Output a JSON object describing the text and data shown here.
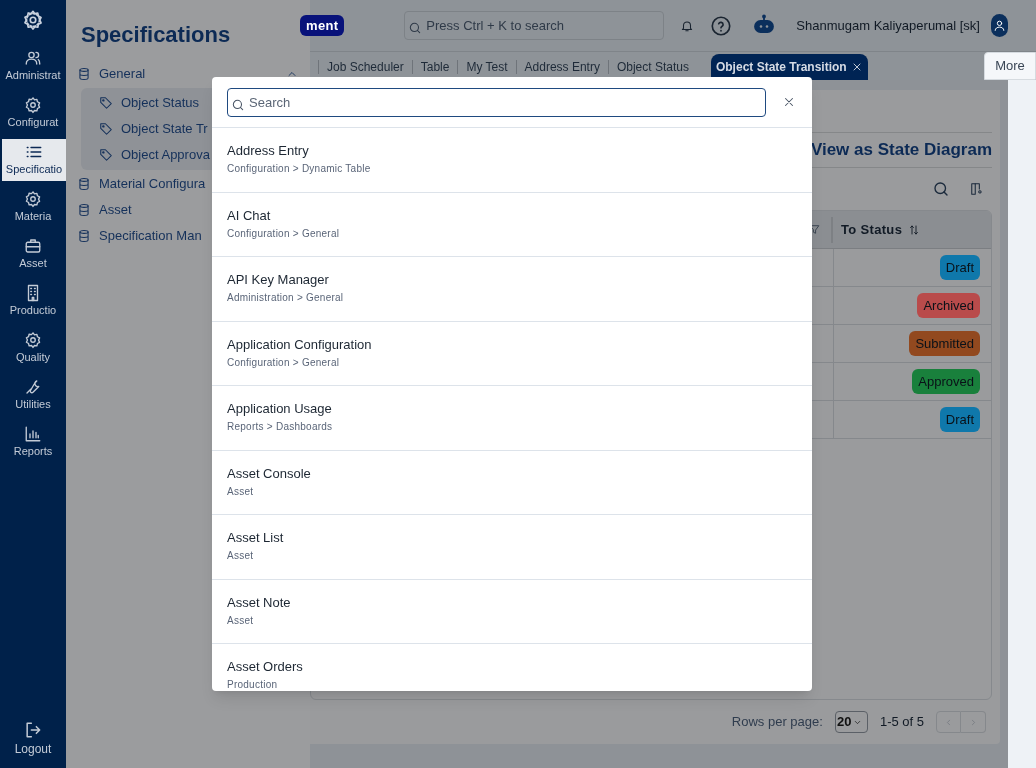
{
  "nav": {
    "items": [
      {
        "label": "Administrat",
        "selected": false
      },
      {
        "label": "Configurat",
        "selected": false
      },
      {
        "label": "Specificatio",
        "selected": true
      },
      {
        "label": "Materia",
        "selected": false
      },
      {
        "label": "Asset",
        "selected": false
      },
      {
        "label": "Productio",
        "selected": false
      },
      {
        "label": "Quality",
        "selected": false
      },
      {
        "label": "Utilities",
        "selected": false
      },
      {
        "label": "Reports",
        "selected": false
      }
    ],
    "logout": "Logout"
  },
  "panel": {
    "title": "Specifications",
    "tree": [
      {
        "label": "General",
        "expanded": true,
        "children": [
          {
            "label": "Object Status"
          },
          {
            "label": "Object State Tr"
          },
          {
            "label": "Object Approva"
          }
        ]
      },
      {
        "label": "Material Configura"
      },
      {
        "label": "Asset"
      },
      {
        "label": "Specification Man"
      }
    ]
  },
  "header": {
    "badge": "ment",
    "search": {
      "placeholder": "Press Ctrl + K to search"
    },
    "user": "Shanmugam Kaliyaperumal [sk]"
  },
  "tabs": [
    {
      "label": "Job Scheduler",
      "selected": false
    },
    {
      "label": "Table",
      "selected": false
    },
    {
      "label": "My Test",
      "selected": false
    },
    {
      "label": "Address Entry",
      "selected": false
    },
    {
      "label": "Object Status",
      "selected": false
    },
    {
      "label": "Object State Transition",
      "selected": true
    }
  ],
  "more": "More",
  "content": {
    "action": "View as State Diagram",
    "table": {
      "columns": [
        "To Status"
      ],
      "rows": [
        {
          "status": "Draft",
          "color": "#0f78ab"
        },
        {
          "status": "Archived",
          "color": "#b94b4b"
        },
        {
          "status": "Submitted",
          "color": "#92491f"
        },
        {
          "status": "Approved",
          "color": "#19803c"
        },
        {
          "status": "Draft",
          "color": "#0f78ab"
        }
      ]
    },
    "pagination": {
      "label": "Rows per page:",
      "page_size": "20",
      "range": "1-5 of 5"
    }
  },
  "dialog": {
    "search": {
      "placeholder": "Search"
    },
    "results": [
      {
        "title": "Address Entry",
        "path": "Configuration > Dynamic Table"
      },
      {
        "title": "AI Chat",
        "path": "Configuration > General"
      },
      {
        "title": "API Key Manager",
        "path": "Administration > General"
      },
      {
        "title": "Application Configuration",
        "path": "Configuration > General"
      },
      {
        "title": "Application Usage",
        "path": "Reports > Dashboards"
      },
      {
        "title": "Asset Console",
        "path": "Asset"
      },
      {
        "title": "Asset List",
        "path": "Asset"
      },
      {
        "title": "Asset Note",
        "path": "Asset"
      },
      {
        "title": "Asset Orders",
        "path": "Production"
      }
    ]
  }
}
